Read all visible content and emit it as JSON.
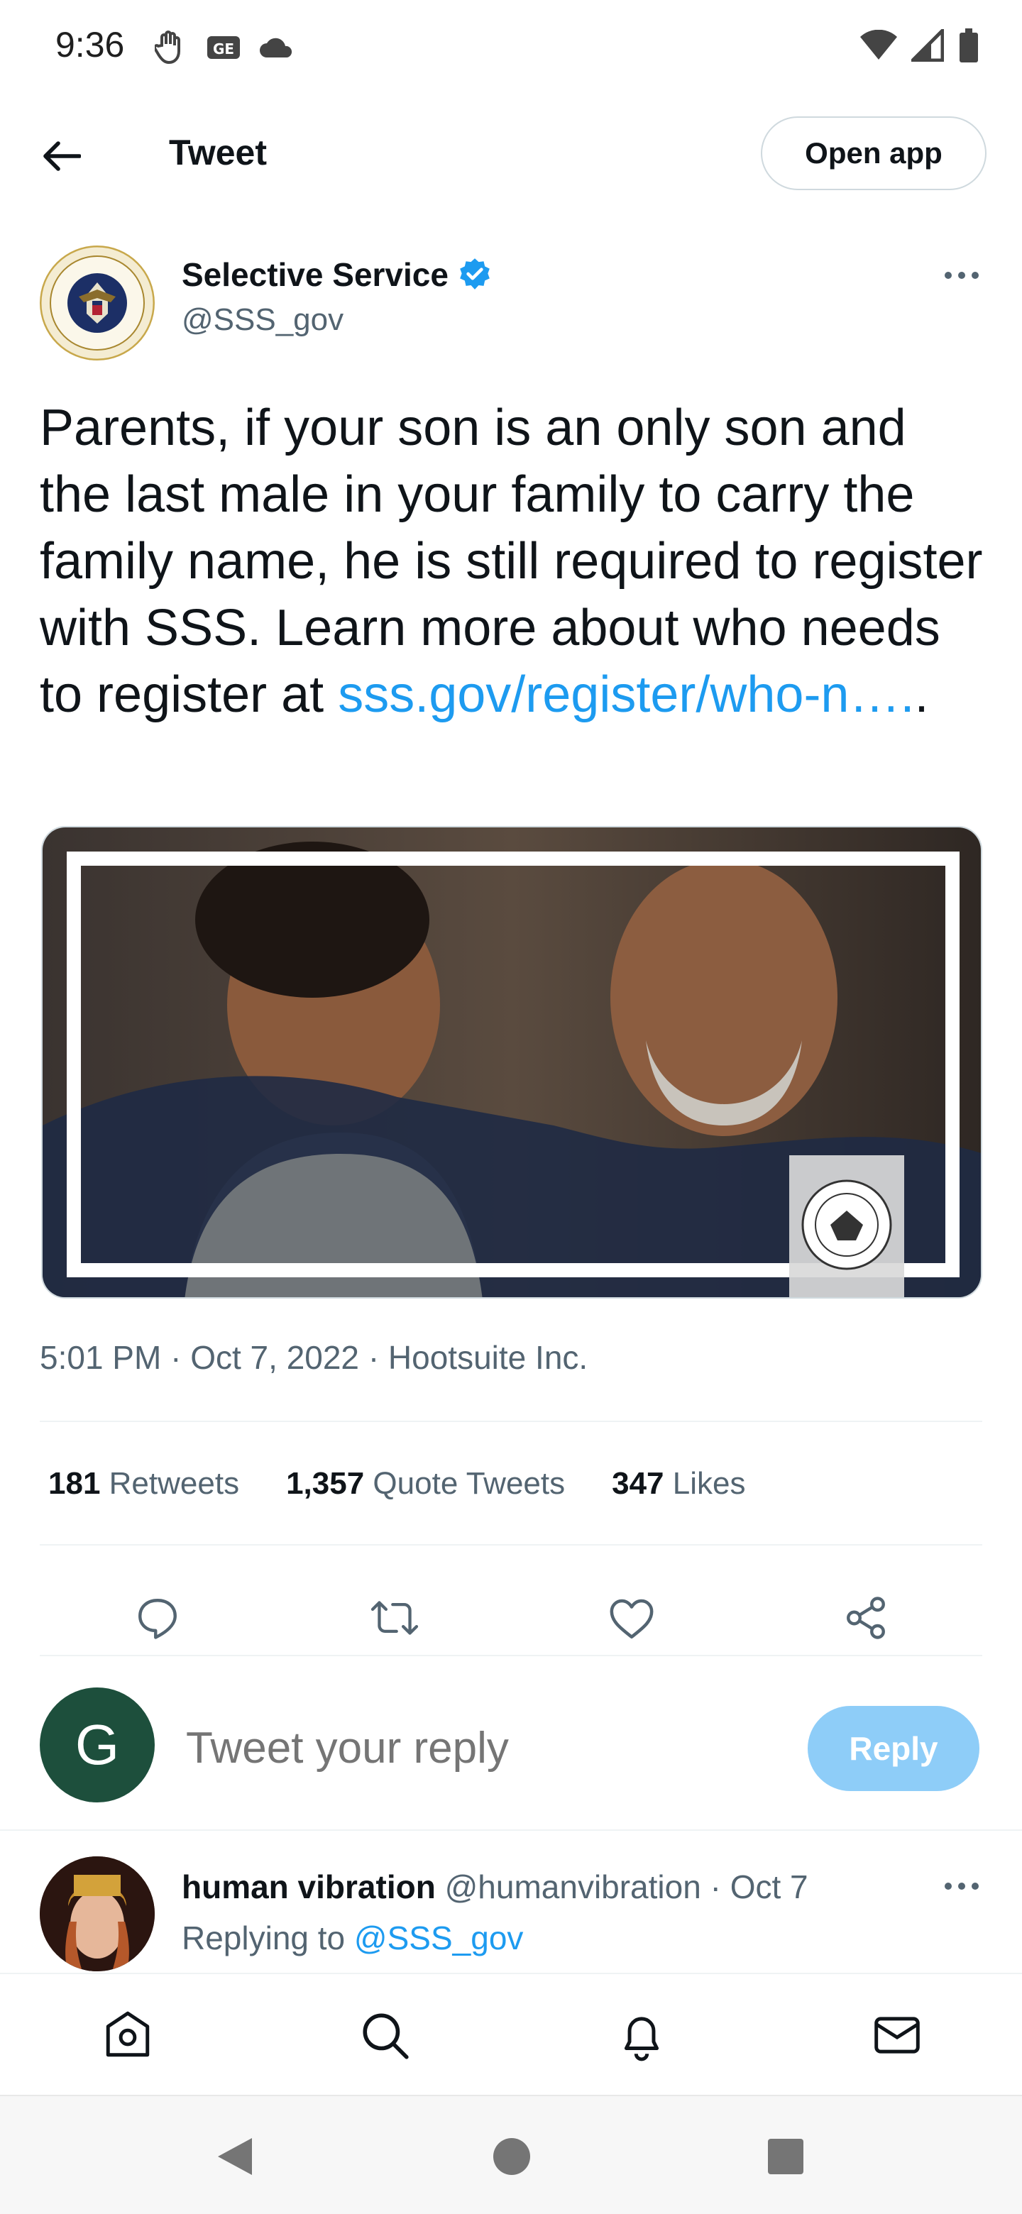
{
  "status_bar": {
    "time": "9:36"
  },
  "header": {
    "title": "Tweet",
    "open_app_label": "Open app"
  },
  "author": {
    "name": "Selective Service",
    "handle": "@SSS_gov",
    "verified": true
  },
  "tweet": {
    "text": "Parents, if your son is an only son and the last male in your family to carry the family name, he is still required to register with SSS. Learn more about who needs to register at ",
    "link": "sss.gov/register/who-n….",
    "link_trailing": "."
  },
  "meta": {
    "time": "5:01 PM",
    "date": "Oct 7, 2022",
    "source": "Hootsuite Inc.",
    "separator": "·"
  },
  "stats": {
    "retweets_count": "181",
    "retweets_label": "Retweets",
    "quotes_count": "1,357",
    "quotes_label": "Quote Tweets",
    "likes_count": "347",
    "likes_label": "Likes"
  },
  "composer": {
    "avatar_letter": "G",
    "placeholder": "Tweet your reply",
    "reply_label": "Reply"
  },
  "reply": {
    "name": "human vibration",
    "handle": "@humanvibration",
    "date": "Oct 7",
    "replying_prefix": "Replying to",
    "replying_to": "@SSS_gov"
  },
  "colors": {
    "accent": "#1d9bf0",
    "reply_button": "#8ecdf8",
    "composer_avatar": "#1d4f3c"
  }
}
